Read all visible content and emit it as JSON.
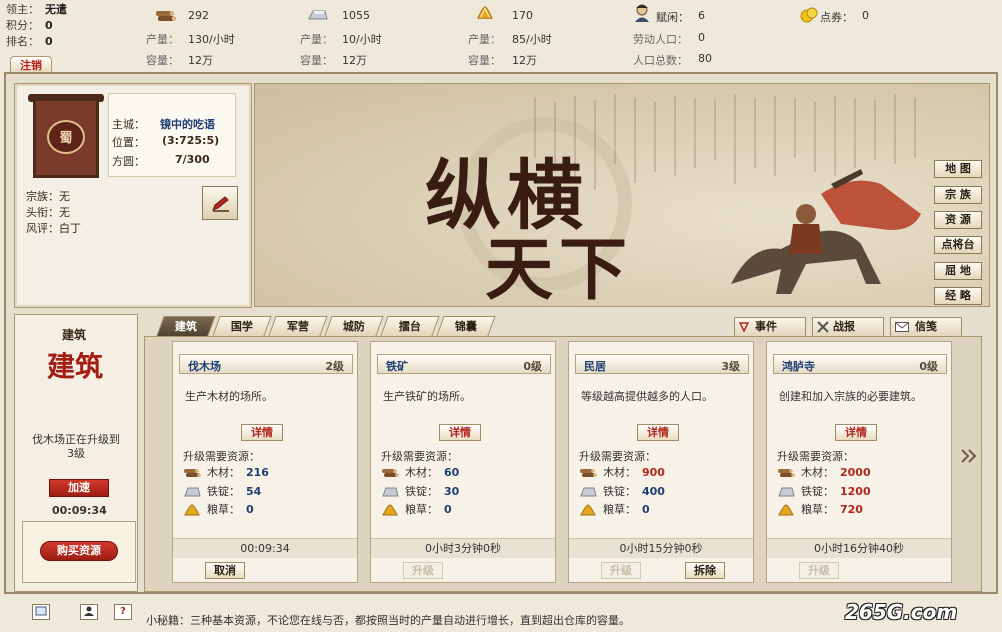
{
  "top": {
    "lord_label": "领主：",
    "lord_value": "无遣",
    "points_label": "积分：",
    "points_value": "0",
    "rank_label": "排名：",
    "rank_value": "0",
    "logout": "注销"
  },
  "resources": {
    "wood": {
      "value": "292",
      "prod_label": "产量：",
      "prod": "130/小时",
      "cap_label": "容量：",
      "cap": "12万"
    },
    "iron": {
      "value": "1055",
      "prod_label": "产量：",
      "prod": "10/小时",
      "cap_label": "容量：",
      "cap": "12万"
    },
    "grain": {
      "value": "170",
      "prod_label": "产量：",
      "prod": "85/小时",
      "cap_label": "容量：",
      "cap": "12万"
    },
    "pop": {
      "idle_label": "赋闲：",
      "idle": "6",
      "labor_label": "劳动人口：",
      "labor": "0",
      "total_label": "人口总数：",
      "total": "80"
    },
    "coupon": {
      "label": "点券：",
      "value": "0"
    }
  },
  "profile": {
    "banner_char": "蜀",
    "city_label": "主城：",
    "city_value": "镜中的吃语",
    "pos_label": "位置：",
    "pos_value": "(3:725:5)",
    "area_label": "方圆：",
    "area_value": "7/300",
    "clan_label": "宗族：",
    "clan_value": "无",
    "title_label": "头衔：",
    "title_value": "无",
    "rep_label": "风评：",
    "rep_value": "白丁"
  },
  "hero": {
    "line1": "纵横",
    "line2": "天下"
  },
  "side_buttons": [
    "地 图",
    "宗 族",
    "资 源",
    "点将台",
    "屈 地",
    "经 略"
  ],
  "build_panel": {
    "title": "建筑",
    "seal": "建筑",
    "status": "伐木场正在升级到",
    "status2": "3级",
    "speed_btn": "加速",
    "timer": "00:09:34",
    "buy_btn": "购买资源"
  },
  "tabs": [
    "建筑",
    "国学",
    "军营",
    "城防",
    "擂台",
    "锦囊"
  ],
  "right_tabs": [
    "事件",
    "战报",
    "信笺"
  ],
  "req_labels": {
    "title": "升级需要资源：",
    "wood": "木材：",
    "iron": "铁锭：",
    "grain": "粮草："
  },
  "detail_label": "详情",
  "cards": [
    {
      "name": "伐木场",
      "level": "2级",
      "desc": "生产木材的场所。",
      "wood": "216",
      "iron": "54",
      "grain": "0",
      "wood_color": "#1f3e74",
      "iron_color": "#1f3e74",
      "grain_color": "#1f3e74",
      "time": "00:09:34",
      "btn1": "取消",
      "btn1_state": "enabled",
      "btn2": ""
    },
    {
      "name": "铁矿",
      "level": "0级",
      "desc": "生产铁矿的场所。",
      "wood": "60",
      "iron": "30",
      "grain": "0",
      "wood_color": "#1f3e74",
      "iron_color": "#1f3e74",
      "grain_color": "#1f3e74",
      "time": "0小时3分钟0秒",
      "btn1": "升级",
      "btn1_state": "disabled",
      "btn2": ""
    },
    {
      "name": "民居",
      "level": "3级",
      "desc": "等级越高提供越多的人口。",
      "wood": "900",
      "iron": "400",
      "grain": "0",
      "wood_color": "#b3261e",
      "iron_color": "#1f3e74",
      "grain_color": "#1f3e74",
      "time": "0小时15分钟0秒",
      "btn1": "升级",
      "btn1_state": "disabled",
      "btn2": "拆除"
    },
    {
      "name": "鸿胪寺",
      "level": "0级",
      "desc": "创建和加入宗族的必要建筑。",
      "wood": "2000",
      "iron": "1200",
      "grain": "720",
      "wood_color": "#b3261e",
      "iron_color": "#b3261e",
      "grain_color": "#b3261e",
      "time": "0小时16分钟40秒",
      "btn1": "升级",
      "btn1_state": "disabled",
      "btn2": ""
    }
  ],
  "tip": "小秘籍：三种基本资源，不论您在线与否，都按照当时的产量自动进行增长，直到超出仓库的容量。",
  "watermark": "265G.com"
}
